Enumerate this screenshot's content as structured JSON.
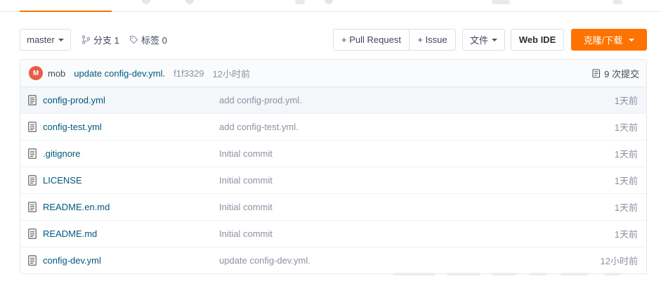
{
  "toolbar": {
    "branch_select": "master",
    "branches": "分支 1",
    "tags": "标签 0",
    "pull_request": "+ Pull Request",
    "issue": "+ Issue",
    "file_menu": "文件",
    "web_ide": "Web IDE",
    "clone": "克隆/下载"
  },
  "commit": {
    "avatar_letter": "M",
    "author": "mob",
    "message": "update config-dev.yml.",
    "hash": "f1f3329",
    "time": "12小时前",
    "count": "9 次提交"
  },
  "files": [
    {
      "name": "config-prod.yml",
      "message": "add config-prod.yml.",
      "time": "1天前"
    },
    {
      "name": "config-test.yml",
      "message": "add config-test.yml.",
      "time": "1天前"
    },
    {
      "name": ".gitignore",
      "message": "Initial commit",
      "time": "1天前"
    },
    {
      "name": "LICENSE",
      "message": "Initial commit",
      "time": "1天前"
    },
    {
      "name": "README.en.md",
      "message": "Initial commit",
      "time": "1天前"
    },
    {
      "name": "README.md",
      "message": "Initial commit",
      "time": "1天前"
    },
    {
      "name": "config-dev.yml",
      "message": "update config-dev.yml.",
      "time": "12小时前"
    }
  ],
  "colors": {
    "accent": "#fe7300",
    "link": "#005980",
    "muted": "#8c92a4"
  }
}
